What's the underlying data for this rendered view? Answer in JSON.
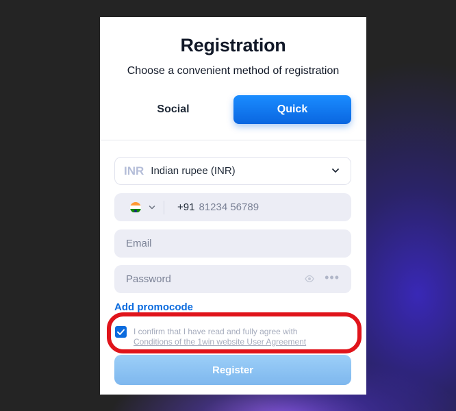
{
  "modal": {
    "title": "Registration",
    "subtitle": "Choose a convenient method of registration",
    "tabs": [
      {
        "label": "Social",
        "active": false
      },
      {
        "label": "Quick",
        "active": true
      }
    ],
    "currency": {
      "code": "INR",
      "name": "Indian rupee (INR)"
    },
    "phone": {
      "country": "India",
      "dial_code": "+91",
      "placeholder": "81234 56789"
    },
    "email": {
      "placeholder": "Email"
    },
    "password": {
      "placeholder": "Password",
      "dots": "•••"
    },
    "promo_link": "Add promocode",
    "agreement": {
      "checked": true,
      "line1": "I confirm that I have read and fully agree with",
      "line2": "Conditions of the 1win website User Agreement"
    },
    "register_label": "Register"
  },
  "colors": {
    "accent": "#0b6bde",
    "highlight": "#e0141b",
    "register_button": "#8fc4f4"
  }
}
